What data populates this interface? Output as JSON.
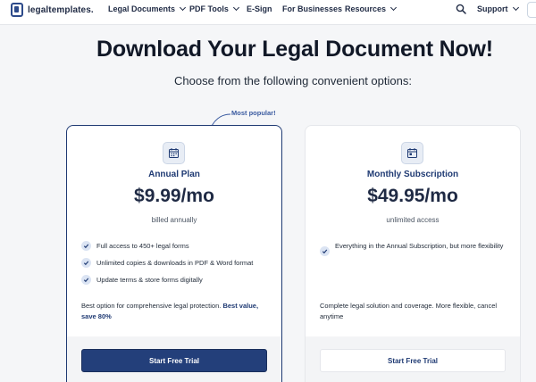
{
  "nav": {
    "logo_text": "legaltemplates.",
    "items": [
      {
        "label": "Legal Documents",
        "has_dropdown": true
      },
      {
        "label": "PDF Tools",
        "has_dropdown": true
      },
      {
        "label": "E-Sign",
        "has_dropdown": false
      },
      {
        "label": "For Businesses",
        "has_dropdown": false
      },
      {
        "label": "Resources",
        "has_dropdown": true
      }
    ],
    "support_label": "Support"
  },
  "header": {
    "title": "Download Your Legal Document Now!",
    "subtitle": "Choose from the following convenient options:"
  },
  "badge": {
    "most_popular": "Most popular!"
  },
  "plans": [
    {
      "name": "Annual Plan",
      "price": "$9.99/mo",
      "billing": "billed annually",
      "features": [
        "Full access to 450+ legal forms",
        "Unlimited copies & downloads in PDF & Word format",
        "Update terms & store forms digitally"
      ],
      "blurb_text": "Best option for comprehensive legal protection. ",
      "blurb_highlight": "Best value, save 80%",
      "cta_label": "Start Free Trial",
      "icon": "calendar-icon"
    },
    {
      "name": "Monthly Subscription",
      "price": "$49.95/mo",
      "billing": "unlimited access",
      "features": [
        "Everything in the Annual Subscription, but more flexibility"
      ],
      "blurb_text": "Complete legal solution and coverage. More flexible, cancel anytime",
      "cta_label": "Start Free Trial",
      "icon": "calendar-icon"
    }
  ],
  "colors": {
    "brand_navy": "#1f3a73",
    "button_primary": "#233f7a",
    "check_bg": "#dbe4f3",
    "page_bg": "#f5f6f8"
  }
}
